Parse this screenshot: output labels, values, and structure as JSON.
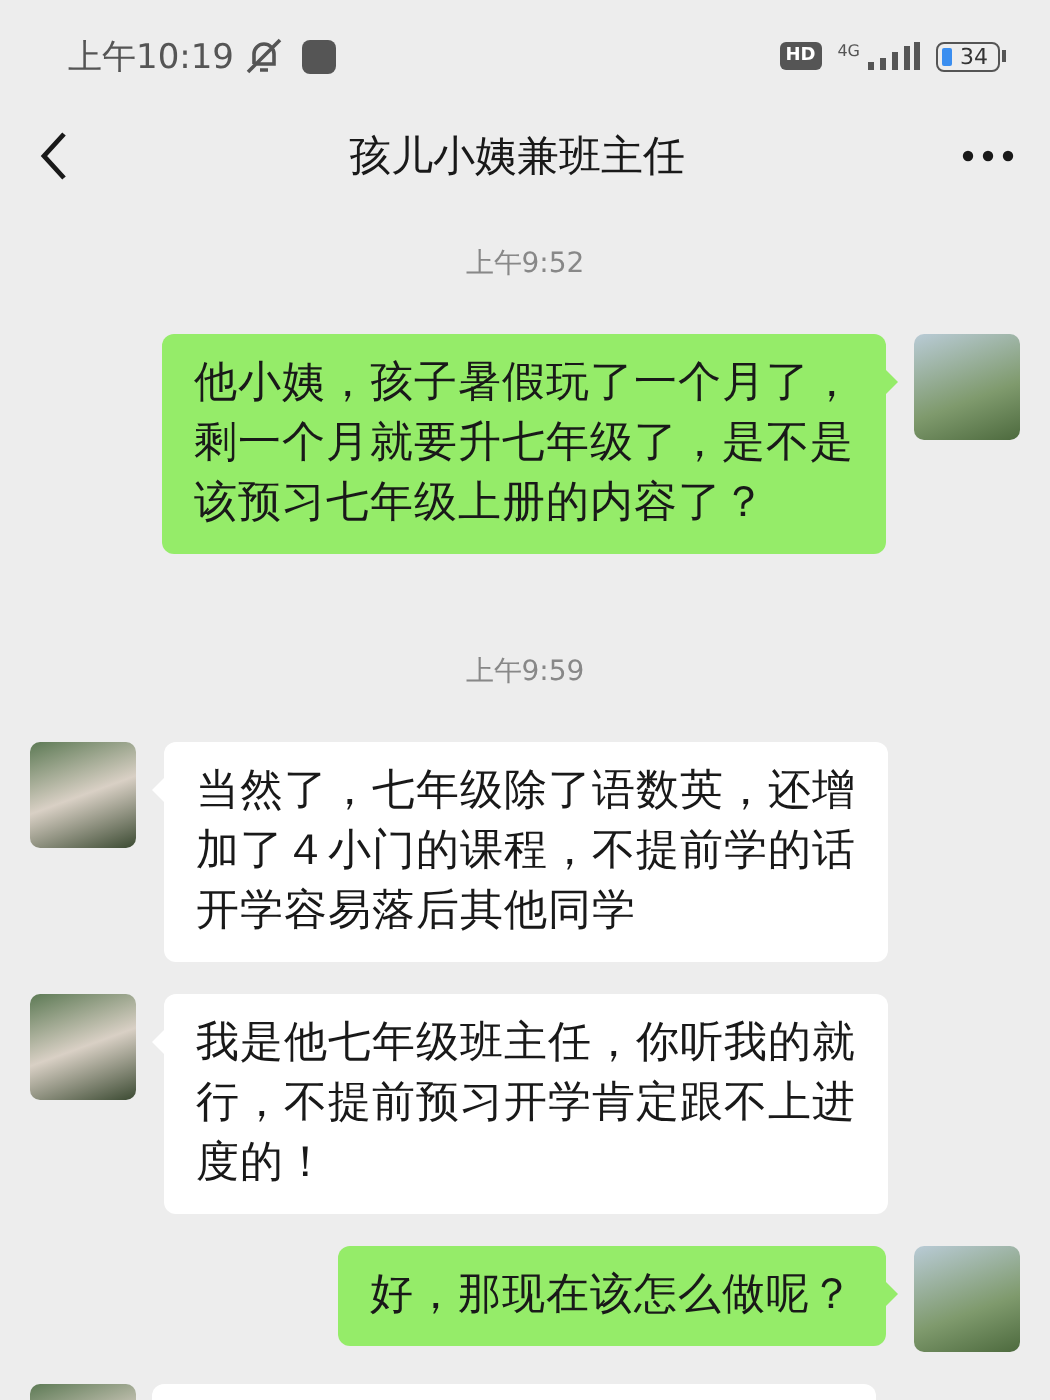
{
  "status_bar": {
    "time": "上午10:19",
    "hd": "HD",
    "network": "4G",
    "battery": "34"
  },
  "header": {
    "title": "孩儿小姨兼班主任"
  },
  "messages": [
    {
      "kind": "time",
      "text": "上午9:52"
    },
    {
      "kind": "outgoing",
      "text": "他小姨，孩子暑假玩了一个月了，剩一个月就要升七年级了，是不是该预习七年级上册的内容了？"
    },
    {
      "kind": "time",
      "text": "上午9:59"
    },
    {
      "kind": "incoming",
      "text": "当然了，七年级除了语数英，还增加了４小门的课程，不提前学的话开学容易落后其他同学"
    },
    {
      "kind": "incoming",
      "text": "我是他七年级班主任，你听我的就行，不提前预习开学肯定跟不上进度的！"
    },
    {
      "kind": "outgoing",
      "text": "好，那现在该怎么做呢？"
    },
    {
      "kind": "incoming"
    }
  ]
}
